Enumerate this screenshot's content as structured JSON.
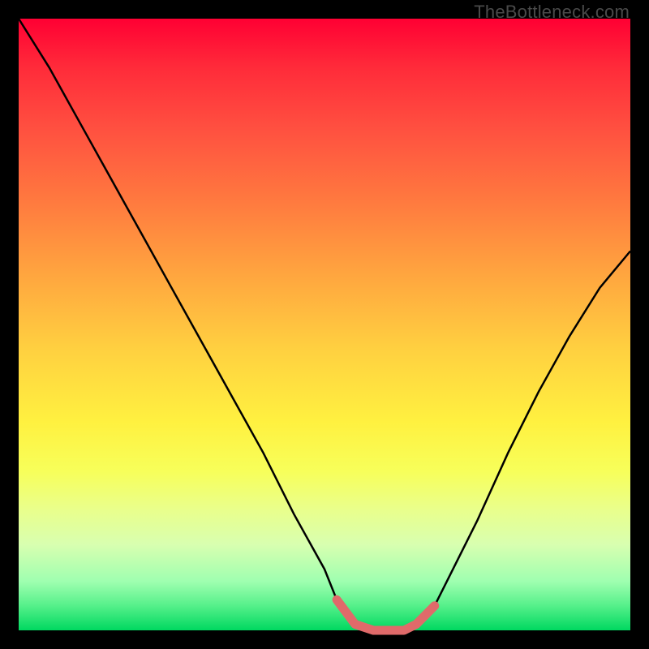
{
  "watermark": "TheBottleneck.com",
  "chart_data": {
    "type": "line",
    "title": "",
    "xlabel": "",
    "ylabel": "",
    "xlim": [
      0,
      100
    ],
    "ylim": [
      0,
      100
    ],
    "series": [
      {
        "name": "bottleneck-curve",
        "x": [
          0,
          5,
          10,
          15,
          20,
          25,
          30,
          35,
          40,
          45,
          50,
          52,
          55,
          58,
          60,
          63,
          65,
          68,
          70,
          75,
          80,
          85,
          90,
          95,
          100
        ],
        "values": [
          100,
          92,
          83,
          74,
          65,
          56,
          47,
          38,
          29,
          19,
          10,
          5,
          1,
          0,
          0,
          0,
          1,
          4,
          8,
          18,
          29,
          39,
          48,
          56,
          62
        ]
      }
    ],
    "annotations": [
      {
        "name": "minimum-highlight",
        "x_range": [
          52,
          68
        ],
        "value": 0,
        "color": "#e06a6a"
      }
    ],
    "colors": {
      "curve": "#000000",
      "highlight": "#e06a6a",
      "background_top": "#ff0033",
      "background_bottom": "#00d860"
    }
  }
}
